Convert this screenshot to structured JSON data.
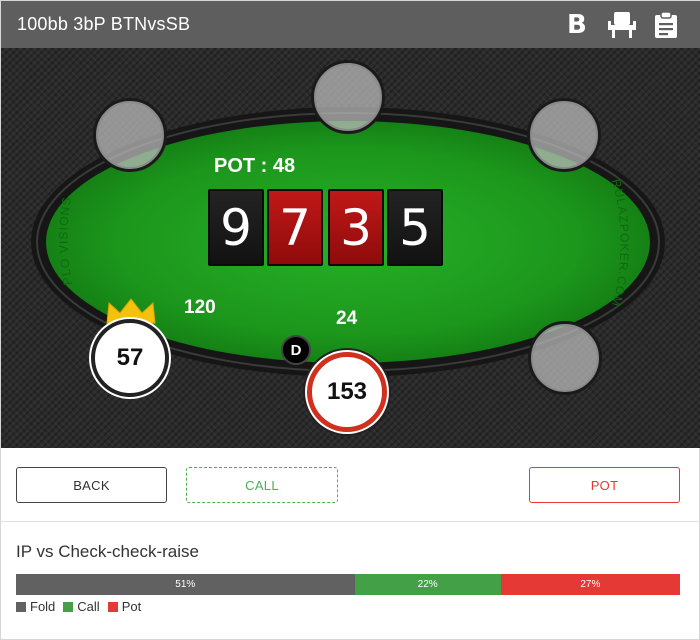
{
  "header": {
    "title": "100bb 3bP BTNvsSB",
    "icons": [
      "bold-b-icon",
      "seat-icon",
      "clipboard-icon"
    ],
    "b_label": "B"
  },
  "table": {
    "pot_label": "POT : 48",
    "board_cards": [
      {
        "rank": "9",
        "color": "black"
      },
      {
        "rank": "7",
        "color": "red"
      },
      {
        "rank": "3",
        "color": "red"
      },
      {
        "rank": "5",
        "color": "black"
      }
    ],
    "branding_left": "PLO VISIONS",
    "branding_right": "RULAZPOKER.COM",
    "players": [
      {
        "stack": "57",
        "bet": "120",
        "has_crown": true
      },
      {
        "stack": "153",
        "bet": "24",
        "is_active": true
      }
    ],
    "dealer_button": "D",
    "felt_color": "#1f9a1f",
    "rail_color": "#1a1a1a"
  },
  "actions": {
    "back": "BACK",
    "call": "CALL",
    "pot": "POT"
  },
  "strategy": {
    "title": "IP vs Check-check-raise",
    "frequencies": [
      {
        "action": "Fold",
        "percent": 51,
        "label": "51%",
        "color": "#616161"
      },
      {
        "action": "Call",
        "percent": 22,
        "label": "22%",
        "color": "#43a047"
      },
      {
        "action": "Pot",
        "percent": 27,
        "label": "27%",
        "color": "#e53935"
      }
    ]
  }
}
